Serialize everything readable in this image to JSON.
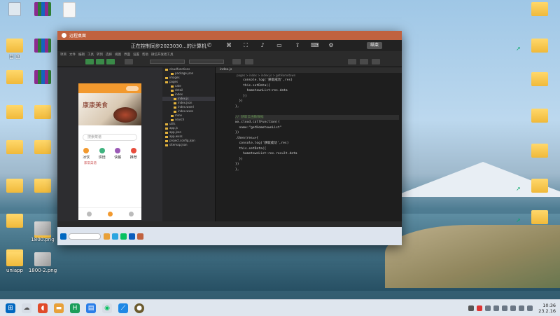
{
  "desktop": {
    "icons_left": [
      {
        "label": "",
        "icon": "recycle-bin-icon"
      },
      {
        "label": "",
        "icon": "winrar-icon"
      },
      {
        "label": "",
        "icon": "document-icon"
      },
      {
        "label": "目 回",
        "icon": "folder-icon"
      },
      {
        "label": "",
        "icon": "winrar-icon"
      },
      {
        "label": "",
        "icon": "winrar-icon"
      },
      {
        "label": "",
        "icon": "folder-icon"
      },
      {
        "label": "",
        "icon": "folder-icon"
      },
      {
        "label": "",
        "icon": "folder-icon"
      },
      {
        "label": "",
        "icon": "folder-icon"
      },
      {
        "label": "",
        "icon": "folder-icon"
      },
      {
        "label": "",
        "icon": "folder-icon"
      },
      {
        "label": "",
        "icon": "folder-icon"
      },
      {
        "label": "",
        "icon": "folder-icon"
      },
      {
        "label": "",
        "icon": "folder-icon"
      },
      {
        "label": "",
        "icon": "folder-icon"
      },
      {
        "label": "1800.png",
        "icon": "image-icon"
      },
      {
        "label": "uniapp",
        "icon": "folder-icon"
      },
      {
        "label": "1800-2.png",
        "icon": "image-icon"
      }
    ],
    "icons_right": [
      {
        "label": "",
        "icon": "folder-icon"
      },
      {
        "label": "",
        "icon": "shortcut-icon"
      },
      {
        "label": "",
        "icon": "folder-icon"
      },
      {
        "label": "",
        "icon": "folder-icon"
      },
      {
        "label": "",
        "icon": "folder-icon"
      },
      {
        "label": "",
        "icon": "shortcut-icon"
      },
      {
        "label": "",
        "icon": "shortcut-icon"
      }
    ]
  },
  "remote": {
    "title": "远程桌面",
    "share_text": "正在控制同步2023030...的计算机",
    "end_button": "结束",
    "menus": [
      "项目",
      "文件",
      "编辑",
      "工具",
      "转到",
      "选择",
      "视图",
      "界面",
      "设置",
      "帮助",
      "微信开发者工具"
    ],
    "simulator": {
      "brand": "康康美食",
      "search_placeholder": "搜索菜谱",
      "categories": [
        {
          "label": "冰饮",
          "color": "#f2992e"
        },
        {
          "label": "烘焙",
          "color": "#3fb37f"
        },
        {
          "label": "快餐",
          "color": "#9b59b6"
        },
        {
          "label": "推荐",
          "color": "#e74c3c"
        }
      ],
      "subtitle": "家常菜谱"
    },
    "explorer": {
      "rows": [
        "cloudfunctions",
        "package.json",
        "images",
        "pages",
        "cate",
        "detail",
        "index",
        "index.js",
        "index.json",
        "index.wxml",
        "index.wxss",
        "mine",
        "search",
        "utils",
        "app.js",
        "app.json",
        "app.wxss",
        "project.config.json",
        "sitemap.json"
      ]
    },
    "editor": {
      "tab": "index.js",
      "crumb": "pages > index > index.js > getHometown",
      "lines": [
        {
          "n": "",
          "html": "    console.log('获取成功',res)"
        },
        {
          "n": "",
          "html": "    this.setData({"
        },
        {
          "n": "",
          "html": "      hometownList:res.data"
        },
        {
          "n": "",
          "html": "    })"
        },
        {
          "n": "",
          "html": "  })"
        },
        {
          "n": "",
          "html": "},"
        },
        {
          "n": "",
          "html": ""
        },
        {
          "n": "",
          "html": "// 获取云函数数据"
        },
        {
          "n": "",
          "html": "wx.cloud.callFunction({"
        },
        {
          "n": "",
          "html": "  name:\"getHometownList\""
        },
        {
          "n": "",
          "html": "})"
        },
        {
          "n": "",
          "html": ".then(res=>{"
        },
        {
          "n": "",
          "html": "  console.log('获取成功',res)"
        },
        {
          "n": "",
          "html": "  this.setData({"
        },
        {
          "n": "",
          "html": "    hometownList:res.result.data"
        },
        {
          "n": "",
          "html": "  })"
        },
        {
          "n": "",
          "html": "})"
        },
        {
          "n": "",
          "html": "},"
        }
      ]
    }
  },
  "taskbar": {
    "time": "10:36",
    "date": "23.2.16"
  }
}
